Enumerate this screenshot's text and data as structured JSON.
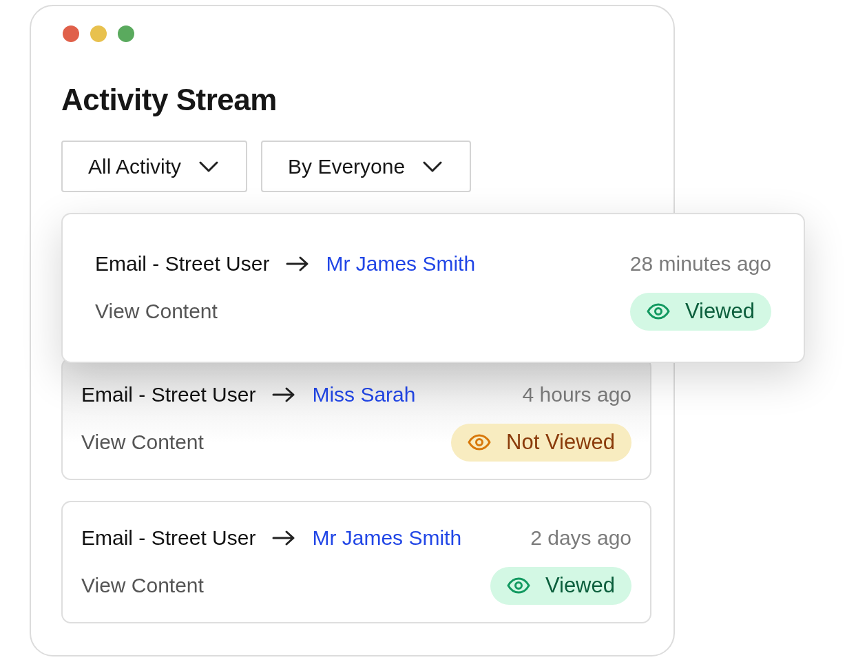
{
  "title": "Activity Stream",
  "filters": [
    {
      "label": "All Activity"
    },
    {
      "label": "By Everyone"
    }
  ],
  "activities": [
    {
      "type": "Email - Street User",
      "recipient": "Mr James Smith",
      "time": "28 minutes ago",
      "action": "View Content",
      "selected": true,
      "status": {
        "kind": "viewed",
        "label": "Viewed"
      }
    },
    {
      "type": "Email - Street User",
      "recipient": "Miss Sarah",
      "time": "4 hours ago",
      "action": "View Content",
      "selected": false,
      "status": {
        "kind": "not_viewed",
        "label": "Not Viewed"
      }
    },
    {
      "type": "Email - Street User",
      "recipient": "Mr James Smith",
      "time": "2 days ago",
      "action": "View Content",
      "selected": false,
      "status": {
        "kind": "viewed",
        "label": "Viewed"
      }
    }
  ]
}
